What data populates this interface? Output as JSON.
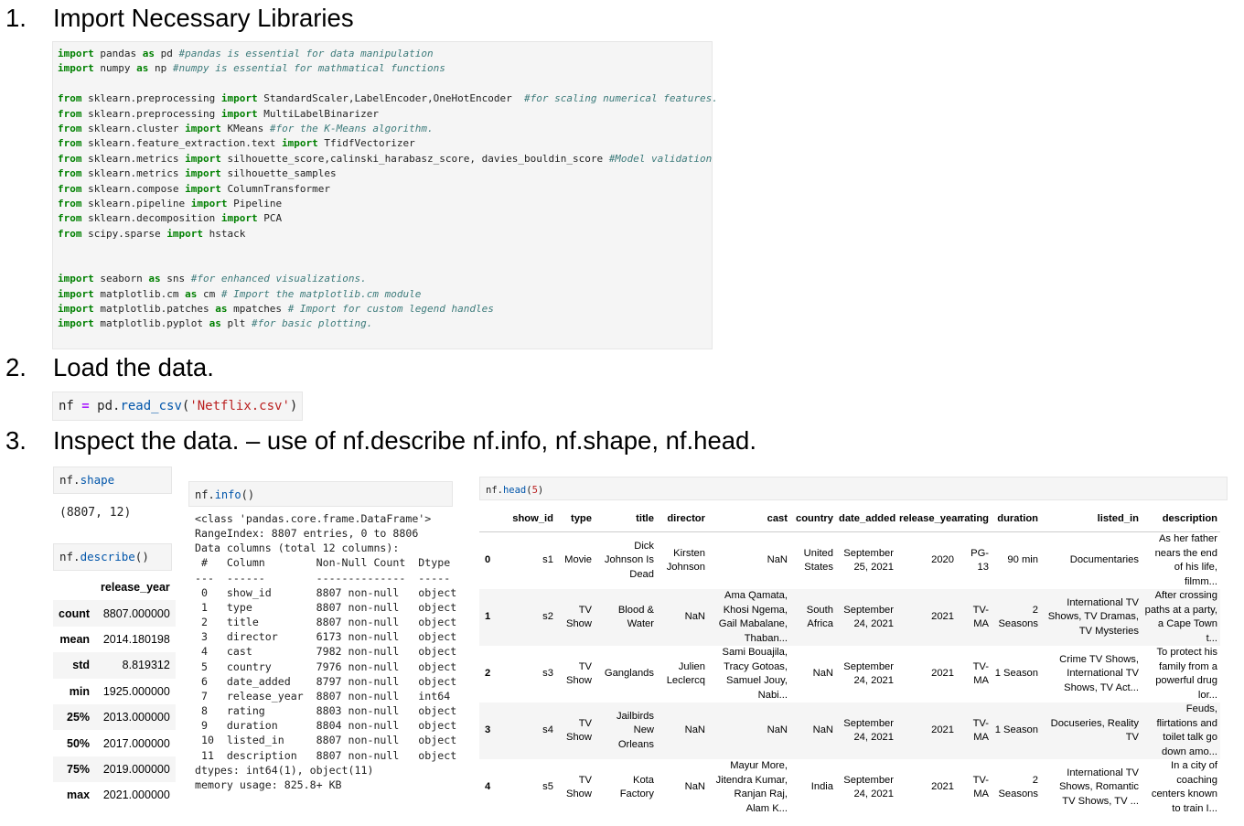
{
  "steps": [
    {
      "num": "1.",
      "text": "Import Necessary Libraries"
    },
    {
      "num": "2.",
      "text": "Load the data."
    },
    {
      "num": "3.",
      "text": "Inspect the data. – use of nf.describe nf.info, nf.shape, nf.head."
    }
  ],
  "import_code": [
    [
      [
        "kw",
        "import"
      ],
      [
        "t",
        " pandas "
      ],
      [
        "kw",
        "as"
      ],
      [
        "t",
        " pd "
      ],
      [
        "cm",
        "#pandas is essential for data manipulation"
      ]
    ],
    [
      [
        "kw",
        "import"
      ],
      [
        "t",
        " numpy "
      ],
      [
        "kw",
        "as"
      ],
      [
        "t",
        " np "
      ],
      [
        "cm",
        "#numpy is essential for mathmatical functions"
      ]
    ],
    [],
    [
      [
        "kw",
        "from"
      ],
      [
        "t",
        " sklearn.preprocessing "
      ],
      [
        "kw",
        "import"
      ],
      [
        "t",
        " StandardScaler,LabelEncoder,OneHotEncoder  "
      ],
      [
        "cm",
        "#for scaling numerical features."
      ]
    ],
    [
      [
        "kw",
        "from"
      ],
      [
        "t",
        " sklearn.preprocessing "
      ],
      [
        "kw",
        "import"
      ],
      [
        "t",
        " MultiLabelBinarizer"
      ]
    ],
    [
      [
        "kw",
        "from"
      ],
      [
        "t",
        " sklearn.cluster "
      ],
      [
        "kw",
        "import"
      ],
      [
        "t",
        " KMeans "
      ],
      [
        "cm",
        "#for the K-Means algorithm."
      ]
    ],
    [
      [
        "kw",
        "from"
      ],
      [
        "t",
        " sklearn.feature_extraction.text "
      ],
      [
        "kw",
        "import"
      ],
      [
        "t",
        " TfidfVectorizer"
      ]
    ],
    [
      [
        "kw",
        "from"
      ],
      [
        "t",
        " sklearn.metrics "
      ],
      [
        "kw",
        "import"
      ],
      [
        "t",
        " silhouette_score,calinski_harabasz_score, davies_bouldin_score "
      ],
      [
        "cm",
        "#Model validation"
      ]
    ],
    [
      [
        "kw",
        "from"
      ],
      [
        "t",
        " sklearn.metrics "
      ],
      [
        "kw",
        "import"
      ],
      [
        "t",
        " silhouette_samples"
      ]
    ],
    [
      [
        "kw",
        "from"
      ],
      [
        "t",
        " sklearn.compose "
      ],
      [
        "kw",
        "import"
      ],
      [
        "t",
        " ColumnTransformer"
      ]
    ],
    [
      [
        "kw",
        "from"
      ],
      [
        "t",
        " sklearn.pipeline "
      ],
      [
        "kw",
        "import"
      ],
      [
        "t",
        " Pipeline"
      ]
    ],
    [
      [
        "kw",
        "from"
      ],
      [
        "t",
        " sklearn.decomposition "
      ],
      [
        "kw",
        "import"
      ],
      [
        "t",
        " PCA"
      ]
    ],
    [
      [
        "kw",
        "from"
      ],
      [
        "t",
        " scipy.sparse "
      ],
      [
        "kw",
        "import"
      ],
      [
        "t",
        " hstack"
      ]
    ],
    [],
    [],
    [
      [
        "kw",
        "import"
      ],
      [
        "t",
        " seaborn "
      ],
      [
        "kw",
        "as"
      ],
      [
        "t",
        " sns "
      ],
      [
        "cm",
        "#for enhanced visualizations."
      ]
    ],
    [
      [
        "kw",
        "import"
      ],
      [
        "t",
        " matplotlib.cm "
      ],
      [
        "kw",
        "as"
      ],
      [
        "t",
        " cm "
      ],
      [
        "cm",
        "# Import the matplotlib.cm module"
      ]
    ],
    [
      [
        "kw",
        "import"
      ],
      [
        "t",
        " matplotlib.patches "
      ],
      [
        "kw",
        "as"
      ],
      [
        "t",
        " mpatches "
      ],
      [
        "cm",
        "# Import for custom legend handles"
      ]
    ],
    [
      [
        "kw",
        "import"
      ],
      [
        "t",
        " matplotlib.pyplot "
      ],
      [
        "kw",
        "as"
      ],
      [
        "t",
        " plt "
      ],
      [
        "cm",
        "#for basic plotting."
      ]
    ]
  ],
  "load_code": [
    [
      [
        "t",
        "nf "
      ],
      [
        "op",
        "="
      ],
      [
        "t",
        " pd."
      ],
      [
        "fn",
        "read_csv"
      ],
      [
        "t",
        "("
      ],
      [
        "st",
        "'Netflix.csv'"
      ],
      [
        "t",
        ")"
      ]
    ]
  ],
  "shape_cell": [
    [
      [
        "t",
        "nf."
      ],
      [
        "fn",
        "shape"
      ]
    ]
  ],
  "shape_output": "(8807, 12)",
  "describe_cell": [
    [
      [
        "t",
        "nf."
      ],
      [
        "fn",
        "describe"
      ],
      [
        "t",
        "()"
      ]
    ]
  ],
  "describe_table": {
    "column": "release_year",
    "rows": [
      {
        "stat": "count",
        "value": "8807.000000"
      },
      {
        "stat": "mean",
        "value": "2014.180198"
      },
      {
        "stat": "std",
        "value": "8.819312"
      },
      {
        "stat": "min",
        "value": "1925.000000"
      },
      {
        "stat": "25%",
        "value": "2013.000000"
      },
      {
        "stat": "50%",
        "value": "2017.000000"
      },
      {
        "stat": "75%",
        "value": "2019.000000"
      },
      {
        "stat": "max",
        "value": "2021.000000"
      }
    ]
  },
  "info_cell": [
    [
      [
        "t",
        "nf."
      ],
      [
        "fn",
        "info"
      ],
      [
        "t",
        "()"
      ]
    ]
  ],
  "info_output": [
    "<class 'pandas.core.frame.DataFrame'>",
    "RangeIndex: 8807 entries, 0 to 8806",
    "Data columns (total 12 columns):",
    " #   Column        Non-Null Count  Dtype",
    "---  ------        --------------  -----",
    " 0   show_id       8807 non-null   object",
    " 1   type          8807 non-null   object",
    " 2   title         8807 non-null   object",
    " 3   director      6173 non-null   object",
    " 4   cast          7982 non-null   object",
    " 5   country       7976 non-null   object",
    " 6   date_added    8797 non-null   object",
    " 7   release_year  8807 non-null   int64",
    " 8   rating        8803 non-null   object",
    " 9   duration      8804 non-null   object",
    " 10  listed_in     8807 non-null   object",
    " 11  description   8807 non-null   object",
    "dtypes: int64(1), object(11)",
    "memory usage: 825.8+ KB"
  ],
  "head_cell": [
    [
      [
        "t",
        "nf."
      ],
      [
        "fn",
        "head"
      ],
      [
        "t",
        "("
      ],
      [
        "st",
        "5"
      ],
      [
        "t",
        ")"
      ]
    ]
  ],
  "head_table": {
    "columns": [
      "",
      "show_id",
      "type",
      "title",
      "director",
      "cast",
      "country",
      "date_added",
      "release_year",
      "rating",
      "duration",
      "listed_in",
      "description"
    ],
    "rows": [
      [
        "0",
        "s1",
        "Movie",
        "Dick Johnson Is Dead",
        "Kirsten Johnson",
        "NaN",
        "United States",
        "September 25, 2021",
        "2020",
        "PG-13",
        "90 min",
        "Documentaries",
        "As her father nears the end of his life, filmm..."
      ],
      [
        "1",
        "s2",
        "TV Show",
        "Blood & Water",
        "NaN",
        "Ama Qamata, Khosi Ngema, Gail Mabalane, Thaban...",
        "South Africa",
        "September 24, 2021",
        "2021",
        "TV-MA",
        "2 Seasons",
        "International TV Shows, TV Dramas, TV Mysteries",
        "After crossing paths at a party, a Cape Town t..."
      ],
      [
        "2",
        "s3",
        "TV Show",
        "Ganglands",
        "Julien Leclercq",
        "Sami Bouajila, Tracy Gotoas, Samuel Jouy, Nabi...",
        "NaN",
        "September 24, 2021",
        "2021",
        "TV-MA",
        "1 Season",
        "Crime TV Shows, International TV Shows, TV Act...",
        "To protect his family from a powerful drug lor..."
      ],
      [
        "3",
        "s4",
        "TV Show",
        "Jailbirds New Orleans",
        "NaN",
        "NaN",
        "NaN",
        "September 24, 2021",
        "2021",
        "TV-MA",
        "1 Season",
        "Docuseries, Reality TV",
        "Feuds, flirtations and toilet talk go down amo..."
      ],
      [
        "4",
        "s5",
        "TV Show",
        "Kota Factory",
        "NaN",
        "Mayur More, Jitendra Kumar, Ranjan Raj, Alam K...",
        "India",
        "September 24, 2021",
        "2021",
        "TV-MA",
        "2 Seasons",
        "International TV Shows, Romantic TV Shows, TV ...",
        "In a city of coaching centers known to train I..."
      ]
    ]
  }
}
